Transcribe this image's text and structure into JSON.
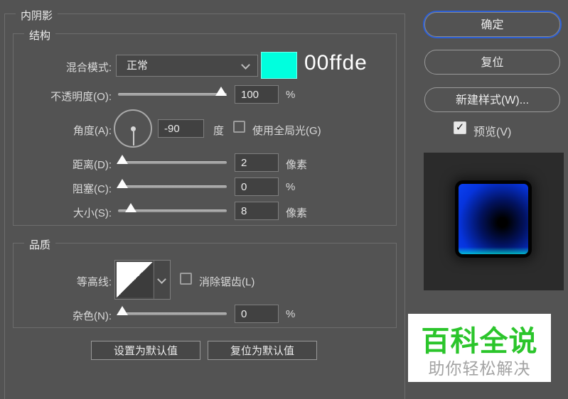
{
  "dialog": {
    "title": "内阴影",
    "structure_group": "结构",
    "quality_group": "品质",
    "blend_mode": {
      "label": "混合模式:",
      "value": "正常",
      "swatch_color": "#00ffde",
      "swatch_style": "background:#00ffde",
      "swatch_hex_text": "00ffde"
    },
    "opacity": {
      "label": "不透明度(O):",
      "value": "100",
      "unit": "%"
    },
    "angle": {
      "label": "角度(A):",
      "value": "-90",
      "unit": "度",
      "global_light_label": "使用全局光(G)",
      "global_light_checked": false
    },
    "distance": {
      "label": "距离(D):",
      "value": "2",
      "unit": "像素"
    },
    "choke": {
      "label": "阻塞(C):",
      "value": "0",
      "unit": "%"
    },
    "size": {
      "label": "大小(S):",
      "value": "8",
      "unit": "像素"
    },
    "contour": {
      "label": "等高线:",
      "anti_alias_label": "消除锯齿(L)",
      "anti_alias_checked": false
    },
    "noise": {
      "label": "杂色(N):",
      "value": "0",
      "unit": "%"
    },
    "set_default_button": "设置为默认值",
    "reset_default_button": "复位为默认值"
  },
  "side_panel": {
    "ok_button": "确定",
    "reset_button": "复位",
    "new_style_button": "新建样式(W)...",
    "preview_label": "预览(V)",
    "preview_checked": true,
    "preview_check_glyph": "✓"
  },
  "banner": {
    "title": "百科全说",
    "title_style": "color:#2bc52b",
    "subtitle": "助你轻松解决"
  },
  "colors": {
    "dialog_background": "#535353",
    "accent_focus_blue": "#2c5fd6",
    "swatch_cyan": "#00ffde",
    "banner_green": "#2bc52b",
    "preview_panel": "#2b2b2b"
  }
}
